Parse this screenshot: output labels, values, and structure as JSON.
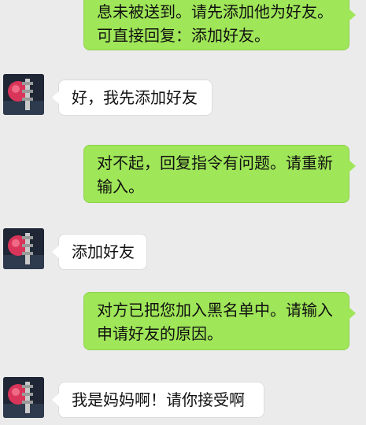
{
  "messages": [
    {
      "side": "out",
      "text": "息未被送到。请先添加他为好友。\n可直接回复：添加好友。"
    },
    {
      "side": "in",
      "text": "好，我先添加好友",
      "avatar": "user-avatar-icon"
    },
    {
      "side": "out",
      "text": "对不起，回复指令有问题。请重新\n输入。"
    },
    {
      "side": "in",
      "text": "添加好友",
      "avatar": "user-avatar-icon"
    },
    {
      "side": "out",
      "text": "对方已把您加入黑名单中。请输入\n申请好友的原因。"
    },
    {
      "side": "in",
      "text": "我是妈妈啊！请你接受啊",
      "avatar": "user-avatar-icon"
    }
  ],
  "colors": {
    "background": "#ebebeb",
    "outgoing_bubble": "#9fe658",
    "incoming_bubble": "#ffffff"
  }
}
